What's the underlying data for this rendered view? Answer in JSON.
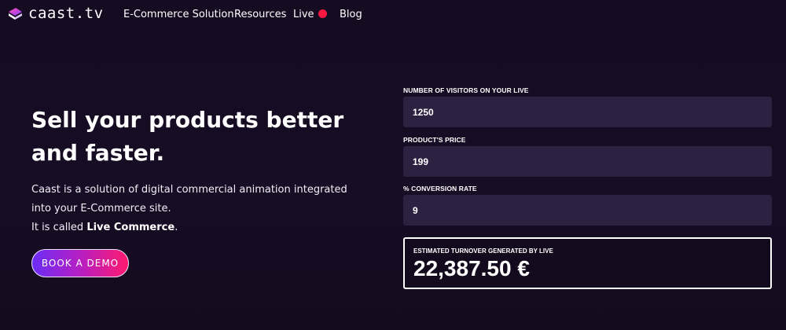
{
  "nav": {
    "logo_text": "caast.tv",
    "links": {
      "ecommerce": "E-Commerce Solution",
      "resources": "Resources",
      "live": "Live",
      "blog": "Blog"
    },
    "live_indicator_color": "#ff1744"
  },
  "hero": {
    "headline": "Sell your products better and faster.",
    "desc_line1": "Caast is a solution of digital commercial animation integrated",
    "desc_line2": "into your E-Commerce site.",
    "desc_line3_prefix": "It is called ",
    "desc_line3_bold": "Live Commerce",
    "desc_line3_suffix": ".",
    "cta_label": "BOOK A DEMO"
  },
  "calculator": {
    "visitors_label": "NUMBER OF VISITORS ON YOUR LIVE",
    "visitors_value": "1250",
    "price_label": "PRODUCT'S PRICE",
    "price_value": "199",
    "conversion_label": "% CONVERSION RATE",
    "conversion_value": "9",
    "result_label": "ESTIMATED TURNOVER GENERATED BY LIVE",
    "result_value": "22,387.50 €"
  },
  "colors": {
    "background": "#150c22",
    "input_bg": "#2c2140",
    "accent_gradient_start": "#6b2cf5",
    "accent_gradient_end": "#ff1a6e"
  }
}
